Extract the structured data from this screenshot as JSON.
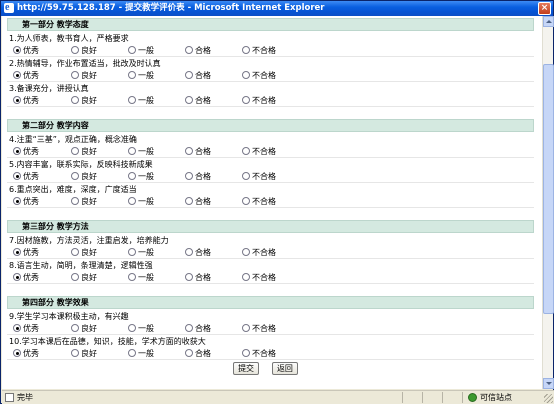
{
  "window": {
    "title": "http://59.75.128.187 - 提交教学评价表 - Microsoft Internet Explorer",
    "close_label": "×"
  },
  "rating_options": [
    "优秀",
    "良好",
    "一般",
    "合格",
    "不合格"
  ],
  "sections": [
    {
      "title": "第一部分  教学态度",
      "questions": [
        {
          "text": "1.为人师表，教书育人，严格要求",
          "selected": 0
        },
        {
          "text": "2.热情辅导，作业布置适当，批改及时认真",
          "selected": 0
        },
        {
          "text": "3.备课充分，讲授认真",
          "selected": 0
        }
      ]
    },
    {
      "title": "第二部分  教学内容",
      "questions": [
        {
          "text": "4.注重“三基”，观点正确，概念准确",
          "selected": 0
        },
        {
          "text": "5.内容丰富，联系实际，反映科技新成果",
          "selected": 0
        },
        {
          "text": "6.重点突出，难度，深度，广度适当",
          "selected": 0
        }
      ]
    },
    {
      "title": "第三部分  教学方法",
      "questions": [
        {
          "text": "7.因材施教，方法灵活，注重启发，培养能力",
          "selected": 0
        },
        {
          "text": "8.语言生动，简明，条理清楚，逻辑性强",
          "selected": 0
        }
      ]
    },
    {
      "title": "第四部分  教学效果",
      "questions": [
        {
          "text": "9.学生学习本课积极主动，有兴趣",
          "selected": 0
        },
        {
          "text": "10.学习本课后在品德，知识，技能，学术方面的收获大",
          "selected": 0
        }
      ]
    }
  ],
  "buttons": {
    "submit_label": "提交",
    "back_label": "返回"
  },
  "statusbar": {
    "status": "完毕",
    "zone": "可信站点"
  }
}
